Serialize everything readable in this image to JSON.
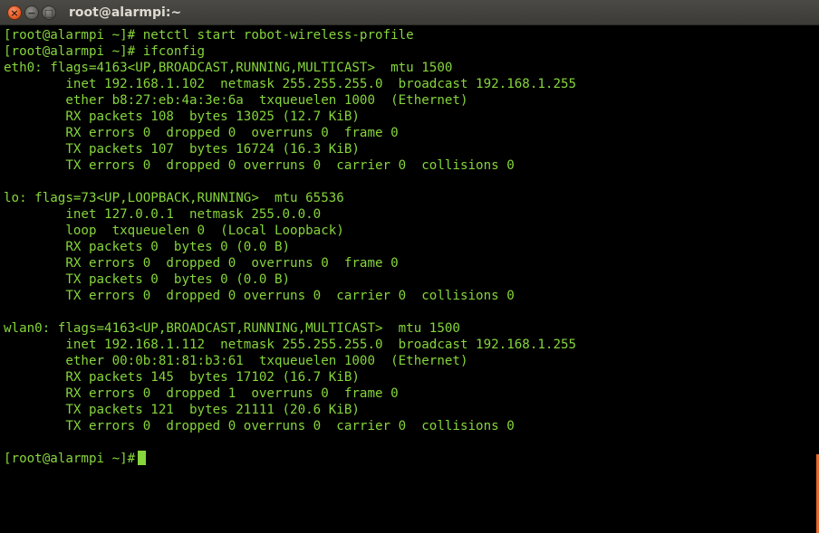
{
  "window": {
    "title": "root@alarmpi:~",
    "controls": {
      "close_label": "×",
      "minimize_label": "−",
      "maximize_label": "□"
    }
  },
  "terminal": {
    "lines": [
      "[root@alarmpi ~]# netctl start robot-wireless-profile",
      "[root@alarmpi ~]# ifconfig",
      "eth0: flags=4163<UP,BROADCAST,RUNNING,MULTICAST>  mtu 1500",
      "        inet 192.168.1.102  netmask 255.255.255.0  broadcast 192.168.1.255",
      "        ether b8:27:eb:4a:3e:6a  txqueuelen 1000  (Ethernet)",
      "        RX packets 108  bytes 13025 (12.7 KiB)",
      "        RX errors 0  dropped 0  overruns 0  frame 0",
      "        TX packets 107  bytes 16724 (16.3 KiB)",
      "        TX errors 0  dropped 0 overruns 0  carrier 0  collisions 0",
      "",
      "lo: flags=73<UP,LOOPBACK,RUNNING>  mtu 65536",
      "        inet 127.0.0.1  netmask 255.0.0.0",
      "        loop  txqueuelen 0  (Local Loopback)",
      "        RX packets 0  bytes 0 (0.0 B)",
      "        RX errors 0  dropped 0  overruns 0  frame 0",
      "        TX packets 0  bytes 0 (0.0 B)",
      "        TX errors 0  dropped 0 overruns 0  carrier 0  collisions 0",
      "",
      "wlan0: flags=4163<UP,BROADCAST,RUNNING,MULTICAST>  mtu 1500",
      "        inet 192.168.1.112  netmask 255.255.255.0  broadcast 192.168.1.255",
      "        ether 00:0b:81:81:b3:61  txqueuelen 1000  (Ethernet)",
      "        RX packets 145  bytes 17102 (16.7 KiB)",
      "        RX errors 0  dropped 1  overruns 0  frame 0",
      "        TX packets 121  bytes 21111 (20.6 KiB)",
      "        TX errors 0  dropped 0 overruns 0  carrier 0  collisions 0",
      ""
    ],
    "prompt": "[root@alarmpi ~]#",
    "colors": {
      "foreground": "#86d53c",
      "background": "#000000"
    }
  }
}
